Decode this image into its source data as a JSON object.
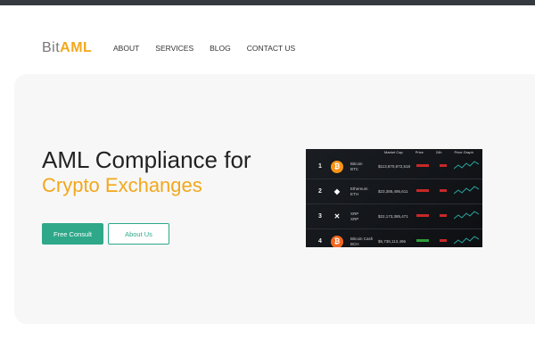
{
  "logo": {
    "part1": "Bit",
    "part2": "AML"
  },
  "nav": [
    "ABOUT",
    "SERVICES",
    "BLOG",
    "CONTACT US"
  ],
  "hero": {
    "title_line1": "AML Compliance for",
    "title_line2": "Crypto Exchanges",
    "primary_button": "Free Consult",
    "secondary_button": "About Us"
  },
  "image": {
    "headers": [
      "Market Cap",
      "Price",
      "24h",
      "Price Graph"
    ],
    "rows": [
      {
        "rank": "1",
        "name": "Bitcoin",
        "symbol": "BTC",
        "cap": "$113,870,872,518",
        "coin_color": "#f7931a",
        "glyph": "₿",
        "price_color": "#c62828"
      },
      {
        "rank": "2",
        "name": "Ethereum",
        "symbol": "ETH",
        "cap": "$23,385,495,611",
        "coin_color": "transparent",
        "glyph": "◆",
        "price_color": "#c62828"
      },
      {
        "rank": "3",
        "name": "XRP",
        "symbol": "XRP",
        "cap": "$22,173,385,471",
        "coin_color": "transparent",
        "glyph": "✕",
        "price_color": "#c62828"
      },
      {
        "rank": "4",
        "name": "Bitcoin Cash",
        "symbol": "BCH",
        "cap": "$5,738,113,496",
        "coin_color": "#f26822",
        "glyph": "₿",
        "price_color": "#2e9d3a"
      }
    ]
  }
}
